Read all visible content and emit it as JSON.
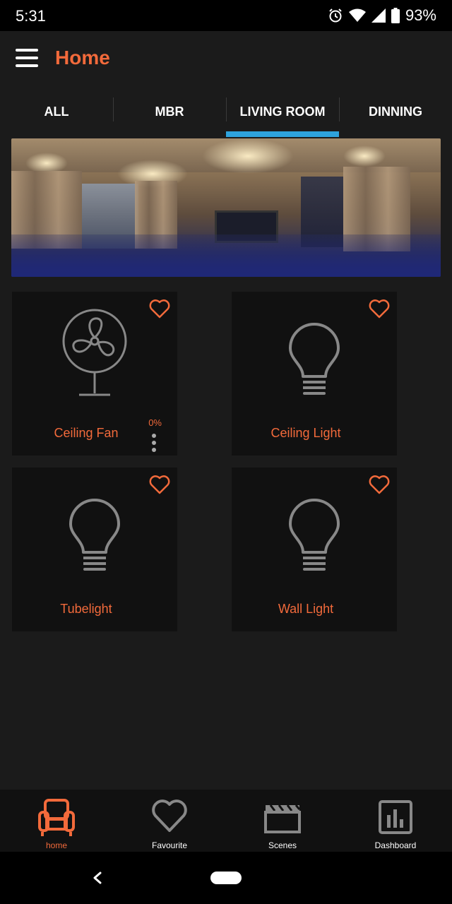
{
  "status": {
    "time": "5:31",
    "battery": "93%"
  },
  "app": {
    "title": "Home"
  },
  "tabs": [
    {
      "label": "ALL"
    },
    {
      "label": "MBR"
    },
    {
      "label": "LIVING ROOM"
    },
    {
      "label": "DINNING"
    }
  ],
  "active_tab": "LIVING ROOM",
  "devices": [
    {
      "name": "Ceiling Fan",
      "icon": "fan-icon",
      "level": "0%",
      "favourite": false
    },
    {
      "name": "Ceiling Light",
      "icon": "bulb-icon",
      "favourite": false
    },
    {
      "name": "Tubelight",
      "icon": "bulb-icon",
      "favourite": false
    },
    {
      "name": "Wall Light",
      "icon": "bulb-icon",
      "favourite": false
    }
  ],
  "bottom_nav": [
    {
      "label": "home",
      "icon": "sofa-icon"
    },
    {
      "label": "Favourite",
      "icon": "heart-icon"
    },
    {
      "label": "Scenes",
      "icon": "clapperboard-icon"
    },
    {
      "label": "Dashboard",
      "icon": "bar-chart-icon"
    }
  ],
  "colors": {
    "accent": "#f26a3b",
    "tab_indicator": "#2ea3dd",
    "background": "#1b1b1b",
    "card": "#111111"
  }
}
